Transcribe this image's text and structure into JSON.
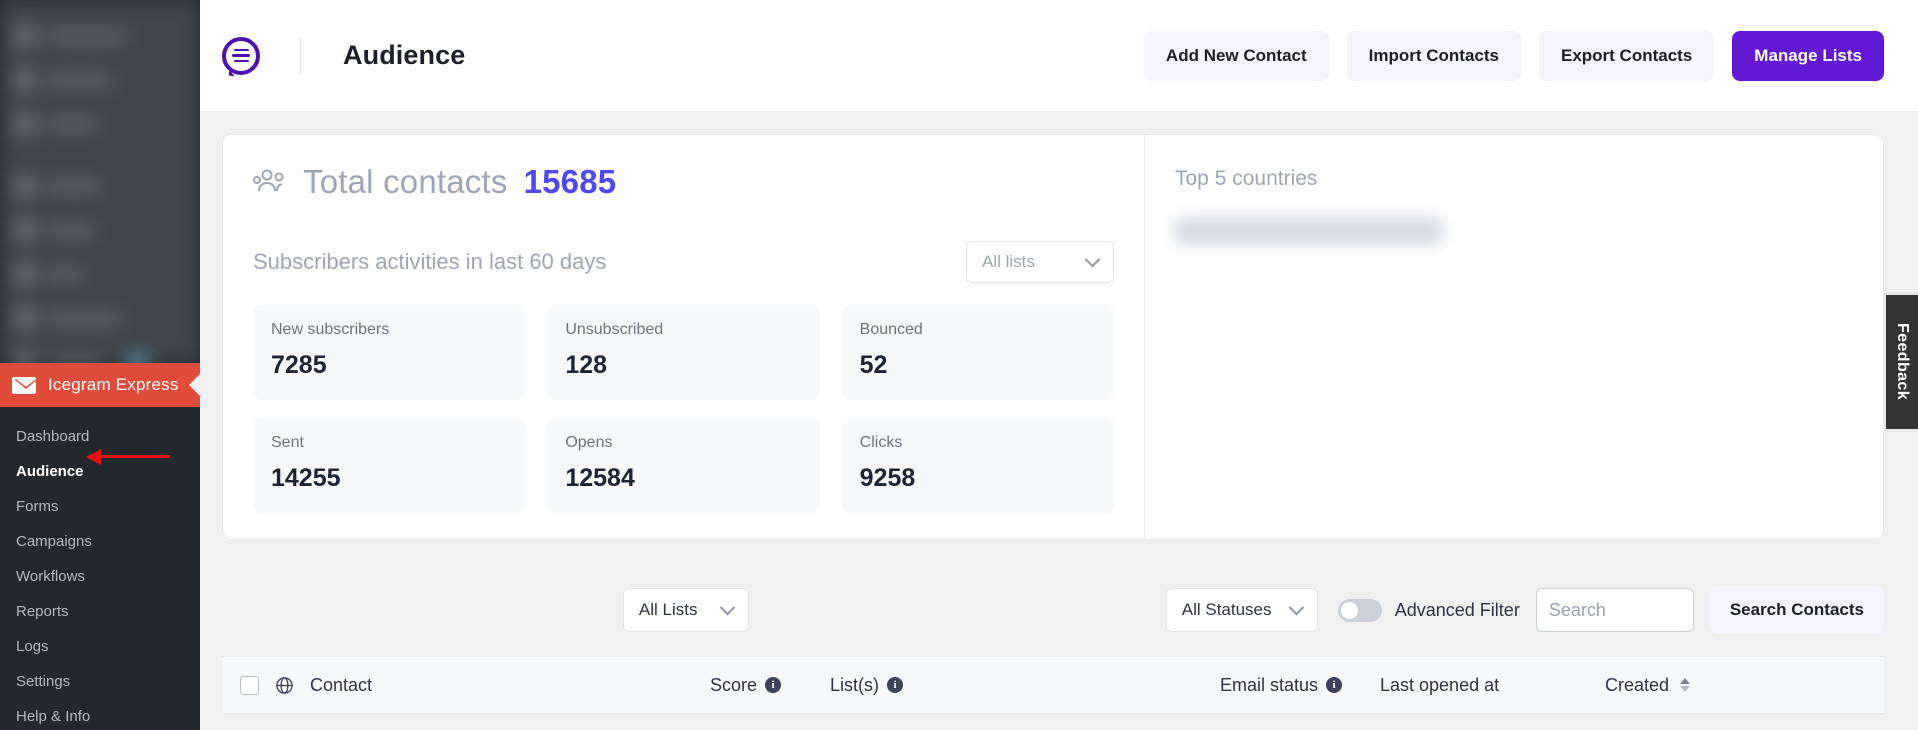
{
  "sidebar": {
    "plugin_name": "Icegram Express",
    "menu": [
      {
        "label": "Dashboard",
        "current": false
      },
      {
        "label": "Audience",
        "current": true
      },
      {
        "label": "Forms",
        "current": false
      },
      {
        "label": "Campaigns",
        "current": false
      },
      {
        "label": "Workflows",
        "current": false
      },
      {
        "label": "Reports",
        "current": false
      },
      {
        "label": "Logs",
        "current": false
      },
      {
        "label": "Settings",
        "current": false
      },
      {
        "label": "Help & Info",
        "current": false
      }
    ]
  },
  "header": {
    "title": "Audience",
    "buttons": [
      {
        "label": "Add New Contact",
        "primary": false
      },
      {
        "label": "Import Contacts",
        "primary": false
      },
      {
        "label": "Export Contacts",
        "primary": false
      },
      {
        "label": "Manage Lists",
        "primary": true
      }
    ]
  },
  "overview": {
    "total_contacts_label": "Total contacts",
    "total_contacts_value": "15685",
    "activities_label": "Subscribers activities in last 60 days",
    "list_filter_value": "All lists",
    "stats": [
      {
        "label": "New subscribers",
        "value": "7285"
      },
      {
        "label": "Unsubscribed",
        "value": "128"
      },
      {
        "label": "Bounced",
        "value": "52"
      },
      {
        "label": "Sent",
        "value": "14255"
      },
      {
        "label": "Opens",
        "value": "12584"
      },
      {
        "label": "Clicks",
        "value": "9258"
      }
    ],
    "top_countries_title": "Top 5 countries"
  },
  "filters": {
    "lists_value": "All Lists",
    "statuses_value": "All Statuses",
    "advanced_filter_label": "Advanced Filter",
    "advanced_filter_on": false,
    "search_placeholder": "Search",
    "search_value": "",
    "search_button_label": "Search Contacts"
  },
  "table": {
    "columns": [
      {
        "label": "Contact",
        "info": false,
        "sort": false
      },
      {
        "label": "Score",
        "info": true,
        "sort": false
      },
      {
        "label": "List(s)",
        "info": true,
        "sort": false
      },
      {
        "label": "Email status",
        "info": true,
        "sort": false
      },
      {
        "label": "Last opened at",
        "info": false,
        "sort": false
      },
      {
        "label": "Created",
        "info": false,
        "sort": true
      }
    ]
  },
  "feedback": {
    "label": "Feedback"
  },
  "colors": {
    "brand_purple": "#6218d4",
    "accent_blue": "#4f46f5",
    "plugin_red": "#e04b3a",
    "annotation_red": "#e81010",
    "sidebar_dark": "#23282d"
  }
}
